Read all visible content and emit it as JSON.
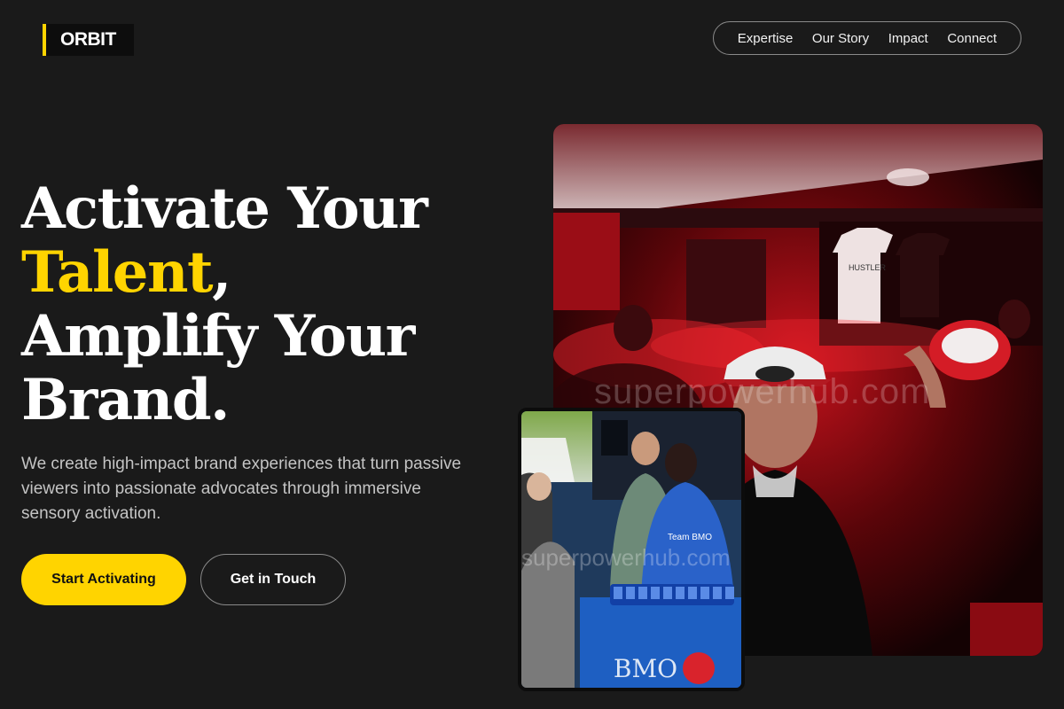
{
  "brand": {
    "logo_text": "ORBIT",
    "accent_color": "#ffd400"
  },
  "nav": {
    "items": [
      {
        "label": "Expertise"
      },
      {
        "label": "Our Story"
      },
      {
        "label": "Impact"
      },
      {
        "label": "Connect"
      }
    ]
  },
  "hero": {
    "headline_line1": "Activate Your",
    "headline_accent": "Talent",
    "headline_comma": ",",
    "headline_line3": "Amplify Your",
    "headline_line4": "Brand.",
    "subtext": "We create high-impact brand experiences that turn passive viewers into passionate advocates through immersive sensory activation.",
    "primary_cta": "Start Activating",
    "secondary_cta": "Get in Touch"
  },
  "images": {
    "main_watermark": "superpowerhub.com",
    "main_cap_text": "HUSTLER",
    "small_watermark": "superpowerhub.com",
    "small_banner_text": "BMO",
    "small_shirt_text": "Team BMO"
  }
}
